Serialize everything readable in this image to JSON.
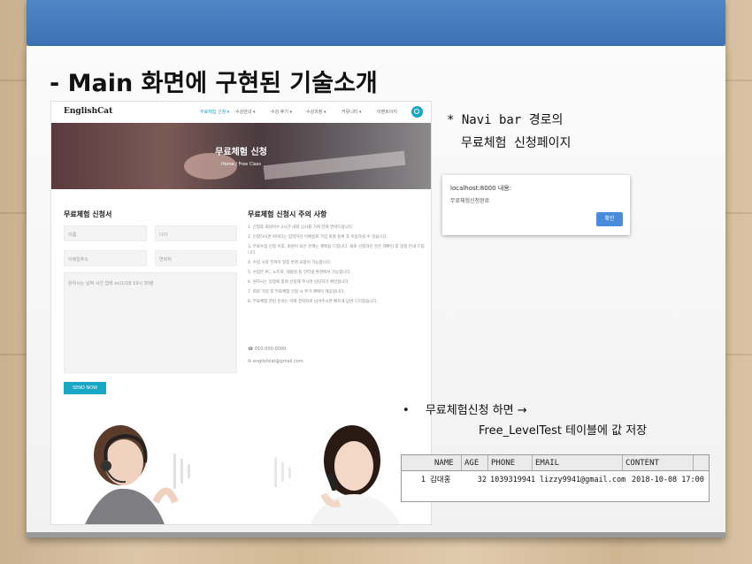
{
  "slide": {
    "title": "- Main 화면에 구현된 기술소개"
  },
  "site": {
    "logo": "EnglishCat",
    "menu": [
      "무료체험 신청 ▾",
      "수강안내 ▾",
      "수강 후기 ▾",
      "수강과정 ▾",
      "커뮤니티 ▾",
      "이벤트이지"
    ],
    "hero_title": "무료체험 신청",
    "hero_crumb": "Home / Free Class",
    "form_title": "무료체험 신청서",
    "fields": [
      "이름",
      "나이",
      "이메일주소",
      "연락처"
    ],
    "textarea_placeholder": "원하시는 날짜 시간 입력 ex)1/18 19시 30분",
    "send_label": "SEND NOW",
    "notice_title": "무료체험 신청시 주의 사항",
    "notices": [
      "1. 신청후 회원이수 2시간 내외 심사를 거쳐 전화 연락드립니다.",
      "2. 신청하시면 아이디는 입력하신 이메일로 가입 회원 등록 후 이용하실 수 있습니다.",
      "3. 무료수업 신청 이후, 회원이 되신 분께는 혜택을 드립니다. 새로 신청하신 분은 재확인 후 일정 안내 드립니다.",
      "4. 수업 시작 전까지 일정 변경 요청이 가능합니다.",
      "5. 수업은 PC, 노트북, 태블릿 등 인터넷 환경에서 가능합니다.",
      "6. 원하시는 일정에 맞춰 신청해 주시면 담당자가 확인합니다.",
      "7. 회원 가입 후 무료체험 신청 시 추가 혜택이 제공됩니다.",
      "8. 무료체험 관련 문의는 아래 연락처로 남겨주시면 빠르게 답변 드리겠습니다."
    ],
    "phone": "010-000-0000",
    "email": "englishcat@gmail.com"
  },
  "annotations": {
    "navi_note_line1": "* Navi bar 경로의",
    "navi_note_line2": "무료체험 신청페이지",
    "bullet": "•",
    "save_note_line1": "무료체험신청 하면 →",
    "save_note_line2": "Free_LevelTest 테이블에 값 저장"
  },
  "dialog": {
    "title": "localhost:8000 내용:",
    "message": "무료체험신청완료",
    "ok_label": "확인"
  },
  "db_table": {
    "columns": [
      "NAME",
      "AGE",
      "PHONE",
      "EMAIL",
      "CONTENT"
    ],
    "rows": [
      {
        "index": "1",
        "name": "김대홍",
        "age": "32",
        "phone": "1039319941",
        "email": "lizzy9941@gmail.com",
        "content": "2018-10-08 17:00"
      }
    ]
  },
  "colors": {
    "accent": "#19a7c6",
    "binder": "#3d72b4",
    "dialog_button": "#4a8bdb"
  }
}
